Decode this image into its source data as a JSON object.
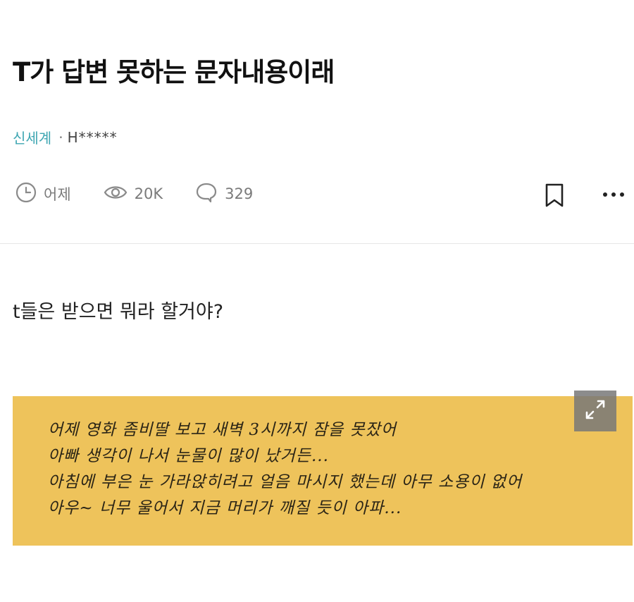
{
  "post": {
    "title": "T가 답변 못하는 문자내용이래",
    "channel": "신세계",
    "separator": "·",
    "author": "H*****",
    "time": "어제",
    "views": "20K",
    "comments": "329",
    "body": "t들은 받으면 뭐라 할거야?"
  },
  "note": {
    "lines": [
      "어제 영화 좀비딸 보고 새벽 3시까지 잠을 못잤어",
      "아빠 생각이 나서 눈물이 많이 났거든...",
      "아침에 부은 눈 가라앉히려고 얼음 마시지 했는데 아무  소용이 없어",
      "아우~ 너무 울어서 지금 머리가 깨질 듯이 아파..."
    ],
    "background_color": "#eec35b"
  },
  "icons": {
    "time": "clock-icon",
    "views": "eye-icon",
    "comments": "comment-bubble-icon",
    "bookmark": "bookmark-icon",
    "more": "more-dots-icon",
    "expand": "expand-arrows-icon"
  },
  "colors": {
    "channel": "#3ea6b2",
    "meta": "#7a7a7a"
  }
}
